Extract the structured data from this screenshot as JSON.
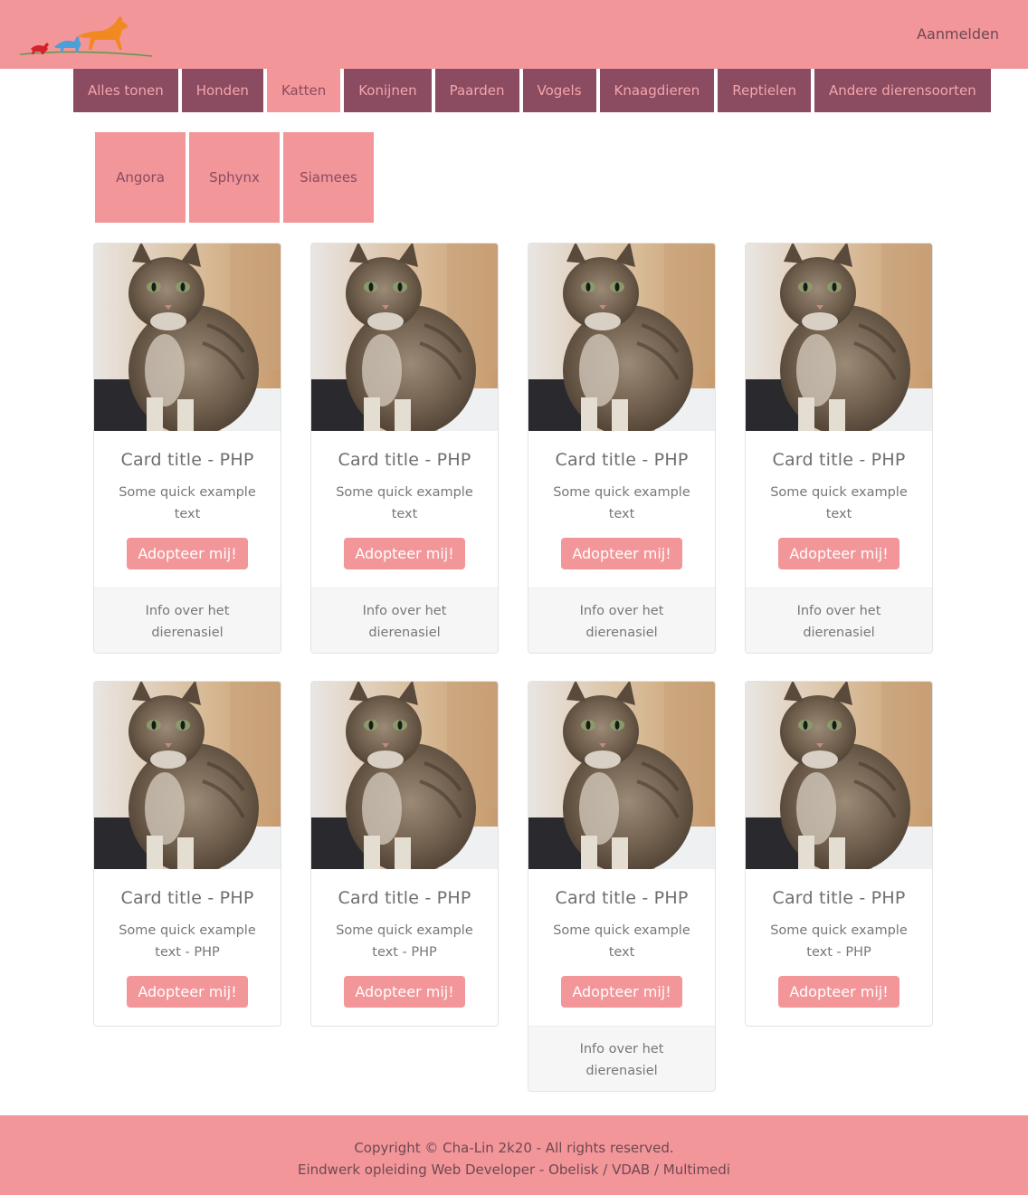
{
  "header": {
    "login_label": "Aanmelden"
  },
  "nav": {
    "tabs": [
      {
        "label": "Alles tonen",
        "active": false
      },
      {
        "label": "Honden",
        "active": false
      },
      {
        "label": "Katten",
        "active": true
      },
      {
        "label": "Konijnen",
        "active": false
      },
      {
        "label": "Paarden",
        "active": false
      },
      {
        "label": "Vogels",
        "active": false
      },
      {
        "label": "Knaagdieren",
        "active": false
      },
      {
        "label": "Reptielen",
        "active": false
      },
      {
        "label": "Andere dierensoorten",
        "active": false
      }
    ]
  },
  "subnav": {
    "items": [
      {
        "label": "Angora"
      },
      {
        "label": "Sphynx"
      },
      {
        "label": "Siamees"
      }
    ]
  },
  "cards": [
    {
      "title": "Card title - PHP",
      "text": "Some quick example text",
      "button": "Adopteer mij!",
      "footer": "Info over het dierenasiel"
    },
    {
      "title": "Card title - PHP",
      "text": "Some quick example text",
      "button": "Adopteer mij!",
      "footer": "Info over het dierenasiel"
    },
    {
      "title": "Card title - PHP",
      "text": "Some quick example text",
      "button": "Adopteer mij!",
      "footer": "Info over het dierenasiel"
    },
    {
      "title": "Card title - PHP",
      "text": "Some quick example text",
      "button": "Adopteer mij!",
      "footer": "Info over het dierenasiel"
    },
    {
      "title": "Card title - PHP",
      "text": "Some quick example text - PHP",
      "button": "Adopteer mij!",
      "footer": null
    },
    {
      "title": "Card title - PHP",
      "text": "Some quick example text - PHP",
      "button": "Adopteer mij!",
      "footer": null
    },
    {
      "title": "Card title - PHP",
      "text": "Some quick example text",
      "button": "Adopteer mij!",
      "footer": "Info over het dierenasiel"
    },
    {
      "title": "Card title - PHP",
      "text": "Some quick example text - PHP",
      "button": "Adopteer mij!",
      "footer": null
    }
  ],
  "footer": {
    "line1": "Copyright © Cha-Lin 2k20 - All rights reserved.",
    "line2": "Eindwerk opleiding Web Developer - Obelisk / VDAB / Multimedi"
  },
  "colors": {
    "brand_pink": "#f29699",
    "nav_purple": "#8b4b61"
  }
}
